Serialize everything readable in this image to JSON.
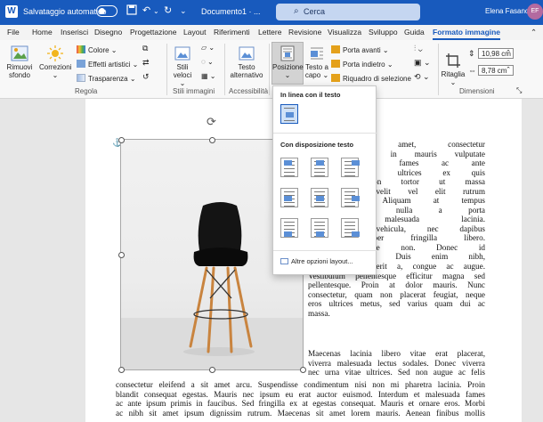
{
  "titlebar": {
    "app_icon": "W",
    "autosave_label": "Salvataggio automatico",
    "doc_title": "Documento1 · ...",
    "search_placeholder": "Cerca",
    "user_name": "Elena Fasano",
    "user_initials": "EF",
    "icons": [
      "save-icon",
      "undo-icon",
      "redo-icon",
      "customize-icon"
    ]
  },
  "menu": {
    "tabs": [
      "File",
      "Home",
      "Inserisci",
      "Disegno",
      "Progettazione",
      "Layout",
      "Riferimenti",
      "Lettere",
      "Revisione",
      "Visualizza",
      "Sviluppo",
      "Guida",
      "Formato immagine"
    ],
    "active_tab": "Formato immagine"
  },
  "ribbon": {
    "remove_bg": "Rimuovi sfondo",
    "corrections": "Correzioni",
    "color": "Colore",
    "artistic": "Effetti artistici",
    "transparency": "Trasparenza",
    "regola_group": "Regola",
    "styles": "Stili veloci",
    "styles_group": "Stili immagini",
    "alt_text": "Testo alternativo",
    "accessibility_group": "Accessibilità",
    "position": "Posizione",
    "wrap": "Testo a capo",
    "bring_forward": "Porta avanti",
    "send_backward": "Porta indietro",
    "selection_pane": "Riquadro di selezione",
    "crop": "Ritaglia",
    "height": "10,98 cm",
    "width": "8,78 cm",
    "dimensions_group": "Dimensioni"
  },
  "dropdown": {
    "inline_header": "In linea con il testo",
    "wrap_header": "Con disposizione testo",
    "more": "Altre opzioni layout..."
  },
  "document": {
    "right_lines": [
      "olor sit amet, consectetur",
      "ce et dui in mauris vulputate",
      "et malesuada fames ac ante",
      "aucibus. Cras ultrices ex quis",
      "er. Ut non tortor ut massa",
      "nteger eu velit vel elit rutrum",
      "ac risus. Aliquam at tempus",
      "r vehicula nulla a porta",
      "hendrerit malesuada lacinia.",
      "ac sem vehicula, nec dapibus",
      "n ullamcorper fringilla libero.",
      "massa posuere non. Donec id",
      "mperdiet leo. Duis enim nibh,"
    ],
    "para1_rest": [
      "laoreet ac hendrerit a, congue ac augue.",
      "Vestibulum pellentesque efficitur magna sed",
      "pellentesque. Proin at dolor mauris. Nunc",
      "consectetur, quam non placerat feugiat, neque",
      "eros ultrices metus, sed varius quam dui ac",
      "massa."
    ],
    "para2": [
      "Maecenas lacinia libero vitae erat placerat,",
      "viverra malesuada lectus sodales. Donec viverra",
      "nec urna vitae ultrices. Sed non augue ac felis"
    ],
    "full_lines": [
      "consectetur eleifend a sit amet arcu. Suspendisse condimentum nisi non mi pharetra lacinia. Proin",
      "blandit consequat egestas. Mauris nec ipsum eu erat auctor euismod. Interdum et malesuada fames",
      "ac ante ipsum primis in faucibus. Sed fringilla ex at egestas consequat. Mauris et ornare eros. Morbi",
      "ac nibh sit amet ipsum dignissim rutrum. Maecenas sit amet lorem mauris. Aenean finibus mollis"
    ]
  },
  "colors": {
    "brand": "#185abd",
    "chair_seat": "#111111",
    "chair_legs": "#c9843f"
  }
}
